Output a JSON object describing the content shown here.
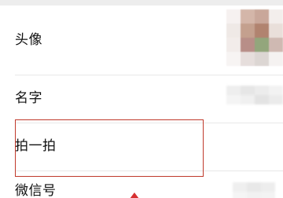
{
  "profile": {
    "rows": [
      {
        "label": "头像"
      },
      {
        "label": "名字"
      },
      {
        "label": "拍一拍"
      },
      {
        "label": "微信号"
      }
    ]
  },
  "colors": {
    "highlight_border": "#c0392b",
    "cursor": "#d63031"
  }
}
